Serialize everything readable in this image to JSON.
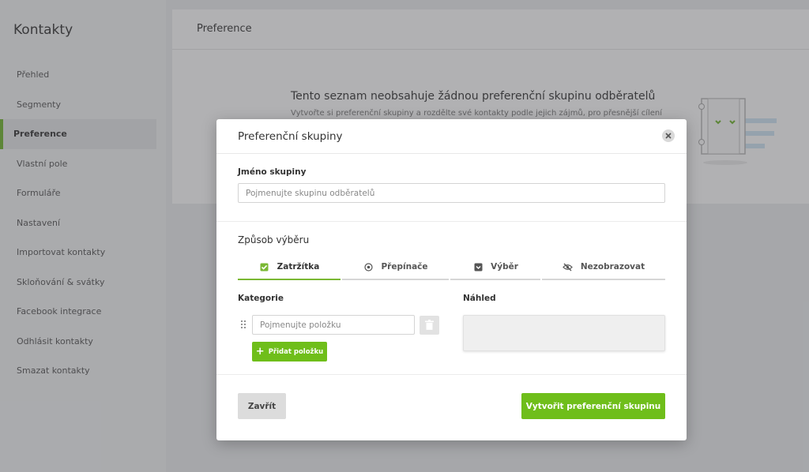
{
  "sidebar": {
    "title": "Kontakty",
    "items": [
      {
        "label": "Přehled",
        "active": false
      },
      {
        "label": "Segmenty",
        "active": false
      },
      {
        "label": "Preference",
        "active": true
      },
      {
        "label": "Vlastní pole",
        "active": false
      },
      {
        "label": "Formuláře",
        "active": false
      },
      {
        "label": "Nastavení",
        "active": false
      },
      {
        "label": "Importovat kontakty",
        "active": false
      },
      {
        "label": "Skloňování & svátky",
        "active": false
      },
      {
        "label": "Facebook integrace",
        "active": false
      },
      {
        "label": "Odhlásit kontakty",
        "active": false
      },
      {
        "label": "Smazat kontakty",
        "active": false
      }
    ],
    "accent_color": "#6fb52c"
  },
  "main": {
    "header_title": "Preference",
    "empty_title": "Tento seznam neobsahuje žádnou preferenční skupinu odběratelů",
    "empty_text": "Vytvořte si preferenční skupiny a rozdělte své kontakty podle jejich zájmů, pro přesnější cílení"
  },
  "modal": {
    "title": "Preferenční skupiny",
    "close_icon": "close-icon",
    "group_name_label": "Jméno skupiny",
    "group_name_placeholder": "Pojmenujte skupinu odběratelů",
    "group_name_value": "",
    "selection_title": "Způsob výběru",
    "tabs": [
      {
        "label": "Zatržítka",
        "icon": "checkbox-icon",
        "active": true
      },
      {
        "label": "Přepínače",
        "icon": "radio-icon",
        "active": false
      },
      {
        "label": "Výběr",
        "icon": "dropdown-icon",
        "active": false
      },
      {
        "label": "Nezobrazovat",
        "icon": "eye-off-icon",
        "active": false
      }
    ],
    "category_label": "Kategorie",
    "item_placeholder": "Pojmenujte položku",
    "item_value": "",
    "add_item_label": "Přidat položku",
    "preview_label": "Náhled",
    "close_label": "Zavřít",
    "create_label": "Vytvořit preferenční skupinu",
    "primary_color": "#6fbe1a"
  }
}
